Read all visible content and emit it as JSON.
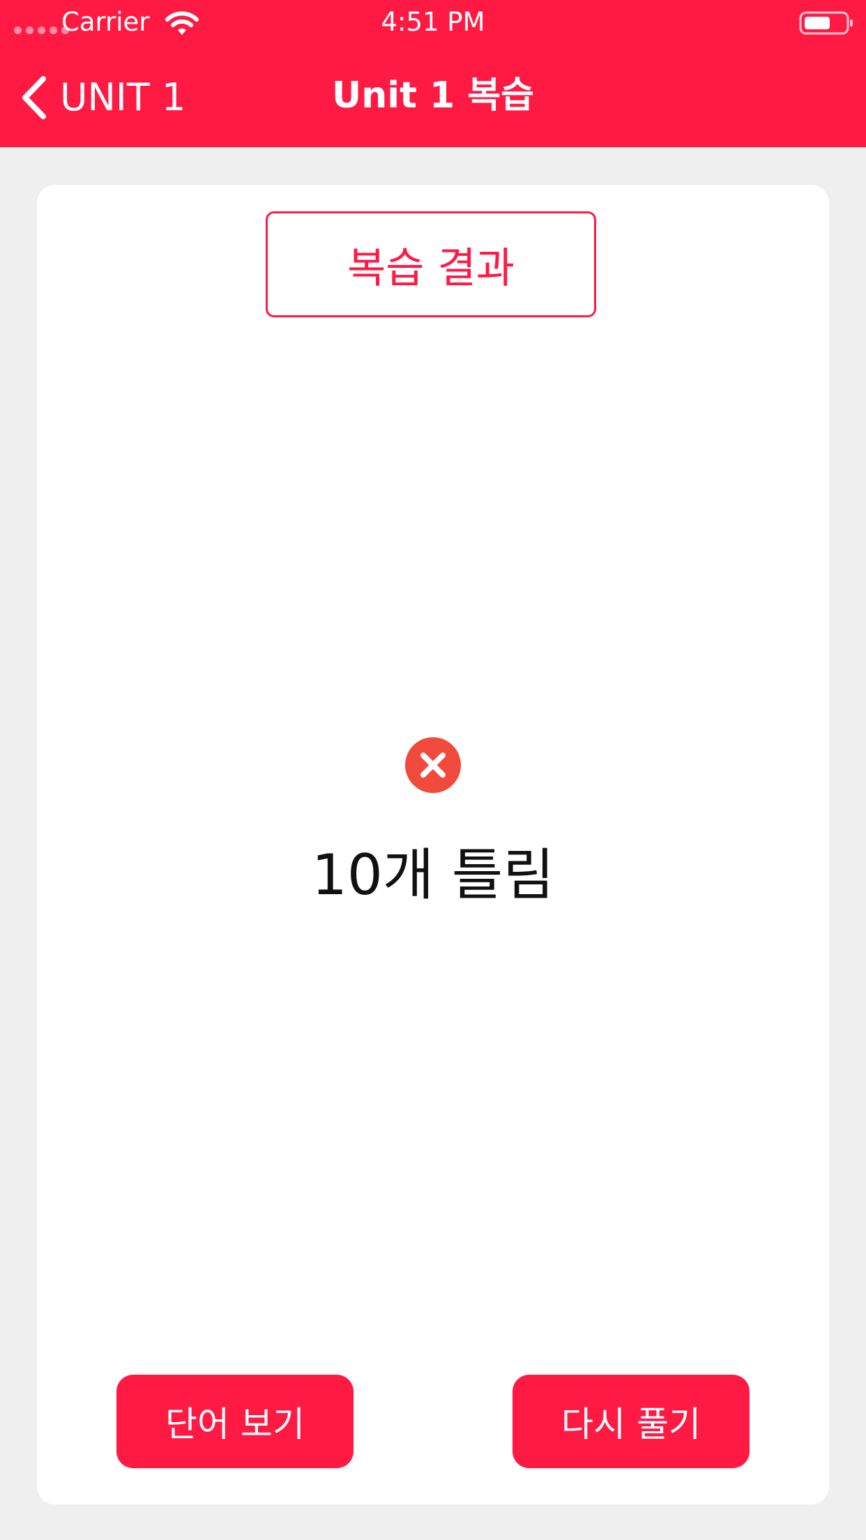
{
  "status_bar": {
    "carrier": "Carrier",
    "time": "4:51 PM"
  },
  "nav": {
    "back_label": "UNIT 1",
    "title": "Unit 1 복습"
  },
  "card": {
    "header": "복습 결과",
    "result_icon": "x-circle-icon",
    "result_text": "10개 틀림",
    "buttons": {
      "view_words": "단어 보기",
      "retry": "다시 풀기"
    }
  },
  "colors": {
    "accent": "#ff1a44",
    "wrong_icon": "#f04a3c",
    "background": "#efefef",
    "card": "#ffffff"
  }
}
